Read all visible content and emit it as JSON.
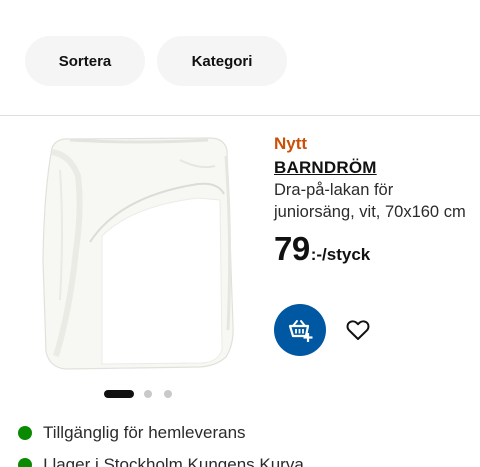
{
  "filters": {
    "sort_label": "Sortera",
    "category_label": "Kategori"
  },
  "product": {
    "badge": "Nytt",
    "name": "BARNDRÖM",
    "description": "Dra-på-lakan för juniorsäng, vit, 70x160 cm",
    "price_integer": "79",
    "price_suffix": ":-/styck",
    "image_icon": "fitted-sheet-photo",
    "carousel": {
      "total": 3,
      "active": 1
    }
  },
  "actions": {
    "add_to_cart_icon": "cart-add-icon",
    "favourite_icon": "heart-icon"
  },
  "availability": [
    {
      "text": "Tillgänglig för hemleverans",
      "status_color": "#0a8a00"
    },
    {
      "text": "I lager i Stockholm Kungens Kurva",
      "status_color": "#0a8a00"
    }
  ],
  "colors": {
    "accent": "#0058a3",
    "new_badge": "#ca5008",
    "in_stock": "#0a8a00"
  }
}
